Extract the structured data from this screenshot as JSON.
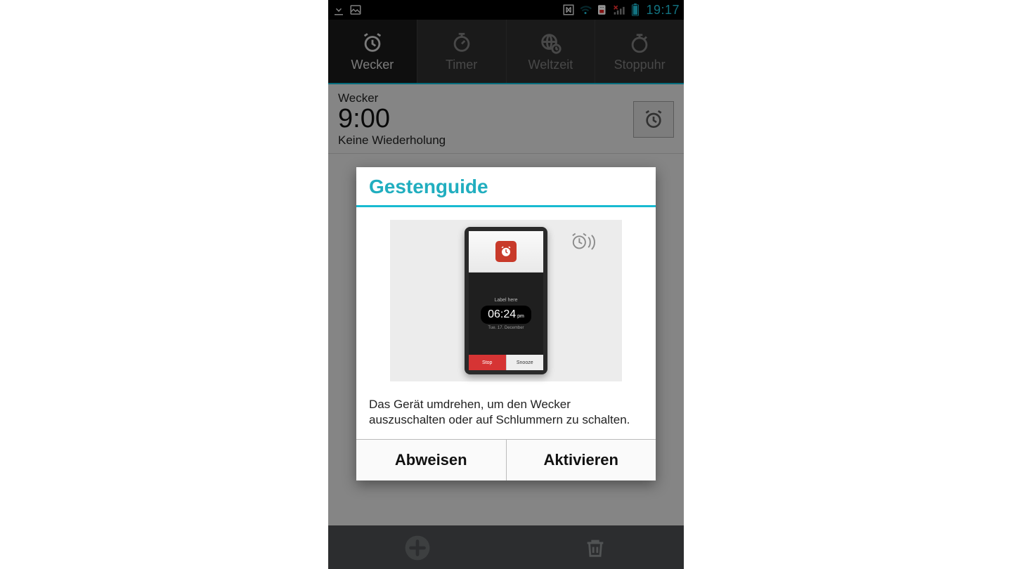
{
  "statusbar": {
    "time": "19:17"
  },
  "tabs": [
    {
      "label": "Wecker",
      "icon": "alarm-icon",
      "active": true
    },
    {
      "label": "Timer",
      "icon": "timer-icon",
      "active": false
    },
    {
      "label": "Weltzeit",
      "icon": "worldtime-icon",
      "active": false
    },
    {
      "label": "Stoppuhr",
      "icon": "stopwatch-icon",
      "active": false
    }
  ],
  "alarm": {
    "label": "Wecker",
    "time": "9:00",
    "repeat": "Keine Wiederholung"
  },
  "dialog": {
    "title": "Gestenguide",
    "illust": {
      "label_here": "Label here",
      "time": "06:24",
      "ampm": "pm",
      "date": "Tue. 17. December",
      "stop": "Stop",
      "snooze": "Snooze"
    },
    "body_text": "Das Gerät umdrehen, um den Wecker auszuschalten oder auf Schlummern zu schalten.",
    "buttons": {
      "dismiss": "Abweisen",
      "activate": "Aktivieren"
    }
  }
}
